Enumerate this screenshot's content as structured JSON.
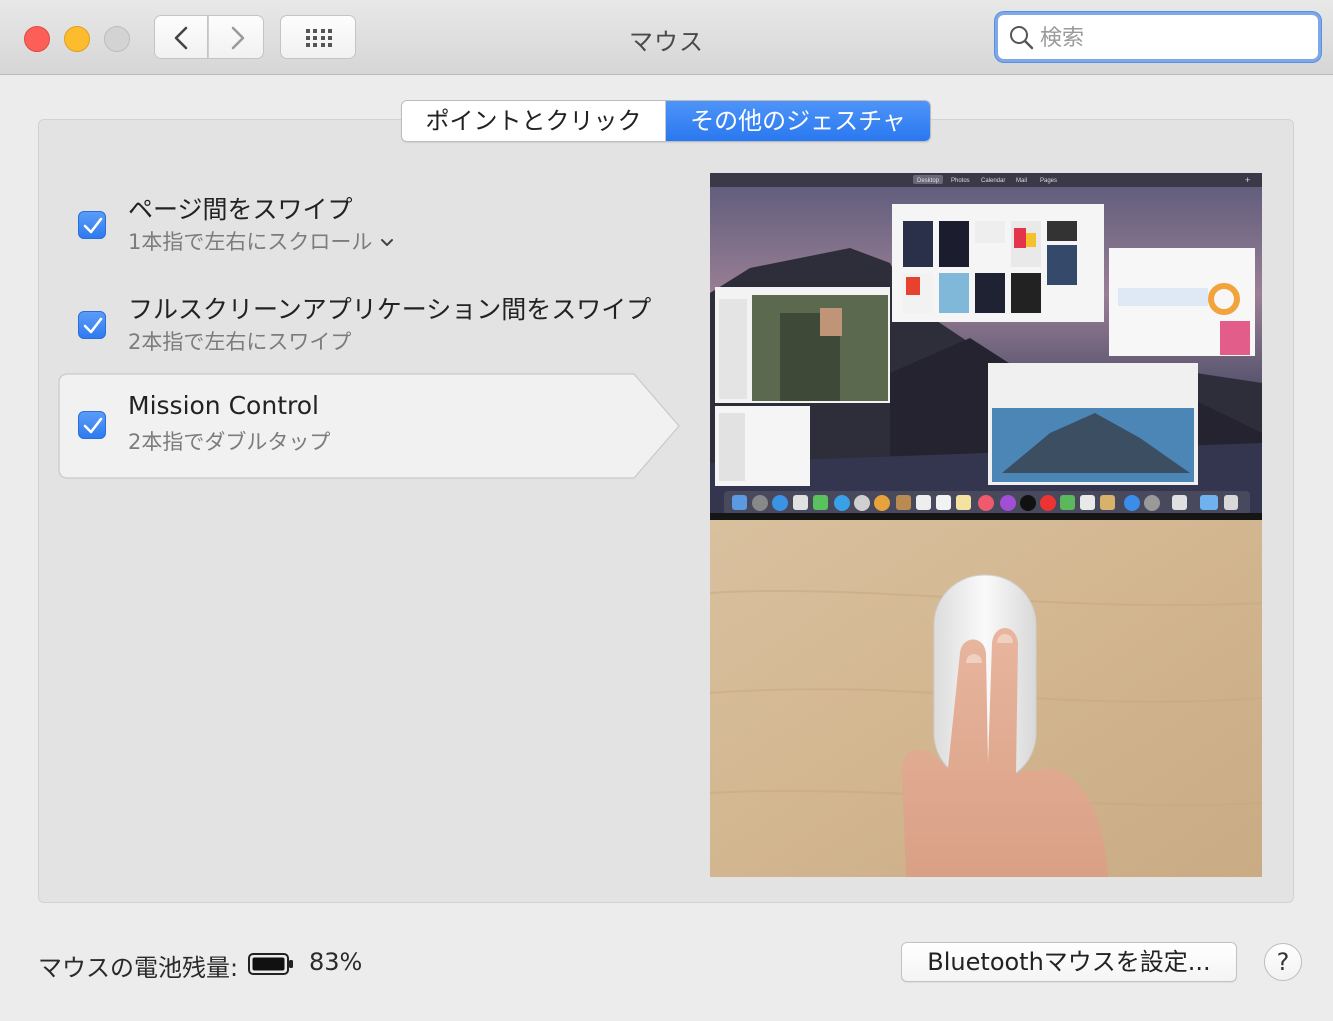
{
  "window": {
    "title": "マウス"
  },
  "search": {
    "placeholder": "検索"
  },
  "tabs": [
    {
      "label": "ポイントとクリック",
      "selected": false
    },
    {
      "label": "その他のジェスチャ",
      "selected": true
    }
  ],
  "gestures": [
    {
      "title": "ページ間をスワイプ",
      "subtitle": "1本指で左右にスクロール",
      "checked": true,
      "has_dropdown": true
    },
    {
      "title": "フルスクリーンアプリケーション間をスワイプ",
      "subtitle": "2本指で左右にスワイプ",
      "checked": true,
      "has_dropdown": false
    },
    {
      "title": "Mission Control",
      "subtitle": "2本指でダブルタップ",
      "checked": true,
      "has_dropdown": false,
      "selected": true
    }
  ],
  "preview": {
    "menubar_items": [
      "Desktop",
      "Photos",
      "Calendar",
      "Mail",
      "Pages"
    ]
  },
  "footer": {
    "battery_label": "マウスの電池残量:",
    "battery_percent": "83%",
    "bluetooth_button": "Bluetoothマウスを設定...",
    "help_label": "?"
  },
  "colors": {
    "accent": "#2f7af0",
    "close": "#fc5f57",
    "minimize": "#fdbc2e",
    "zoom_disabled": "#d3d3d3"
  }
}
